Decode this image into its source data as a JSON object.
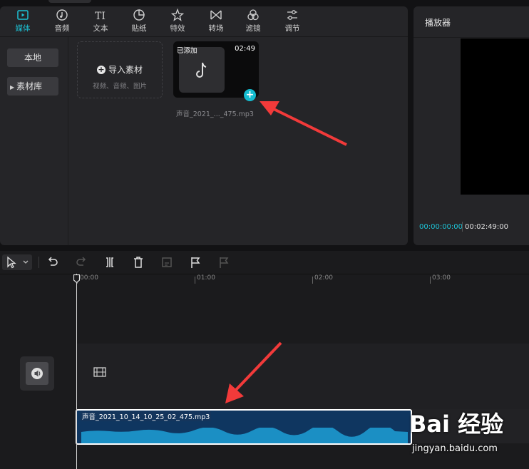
{
  "tabs": [
    {
      "label": "媒体",
      "icon": "media-icon",
      "active": true
    },
    {
      "label": "音频",
      "icon": "audio-icon"
    },
    {
      "label": "文本",
      "icon": "text-icon"
    },
    {
      "label": "贴纸",
      "icon": "sticker-icon"
    },
    {
      "label": "特效",
      "icon": "effects-icon"
    },
    {
      "label": "转场",
      "icon": "transition-icon"
    },
    {
      "label": "滤镜",
      "icon": "filter-icon"
    },
    {
      "label": "调节",
      "icon": "adjust-icon"
    }
  ],
  "tab_icon_glyph_text": "TI",
  "sidebar": {
    "local": "本地",
    "library": "素材库"
  },
  "import": {
    "title": "导入素材",
    "subtitle": "视频、音频、图片"
  },
  "media_card": {
    "added_label": "已添加",
    "duration": "02:49",
    "filename": "声音_2021_..._475.mp3",
    "add_icon": "plus-icon"
  },
  "player": {
    "title": "播放器",
    "timecode_current": "00:00:00:00",
    "timecode_total": "00:02:49:00"
  },
  "ruler": {
    "labels": [
      "00:00",
      "01:00",
      "02:00",
      "03:00"
    ]
  },
  "audio_clip": {
    "name": "声音_2021_10_14_10_25_02_475.mp3"
  },
  "watermark": {
    "logo": "Bai 经验",
    "url": "jingyan.baidu.com"
  },
  "colors": {
    "accent": "#1dc3d6",
    "clip_bg": "#0f3660",
    "waveform": "#1b8fc4",
    "arrow": "#f23a3a"
  }
}
